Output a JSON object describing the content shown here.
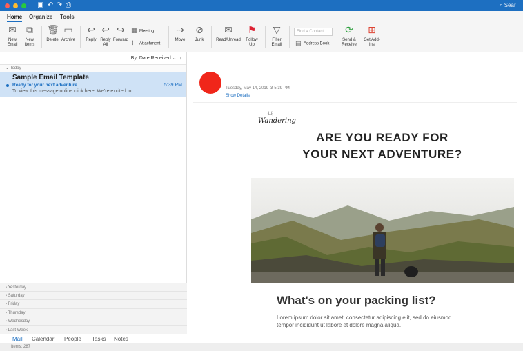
{
  "titlebar": {
    "search_label": "Sear",
    "colors": {
      "bar": "#1d6fc1",
      "close": "#fe5f57",
      "minimize": "#febc2e",
      "maximize": "#28c840"
    }
  },
  "tabs": [
    {
      "label": "Home",
      "active": true
    },
    {
      "label": "Organize"
    },
    {
      "label": "Tools"
    }
  ],
  "ribbon": {
    "new_email": "New Email",
    "new_items": "New Items",
    "delete": "Delete",
    "archive": "Archive",
    "reply": "Reply",
    "reply_all": "Reply All",
    "forward": "Forward",
    "meeting": "Meeting",
    "attachment": "Attachment",
    "move": "Move",
    "junk": "Junk",
    "read_unread": "Read/Unread",
    "follow_up": "Follow Up",
    "filter_email": "Filter Email",
    "find_contact_placeholder": "Find a Contact",
    "address_book": "Address Book",
    "send_receive": "Send & Receive",
    "get_addins": "Get Add-ins"
  },
  "message_list": {
    "sort_label": "By: Date Received",
    "today_group": "Today",
    "item": {
      "from": "Sample Email Template",
      "subject": "Ready for your next adventure",
      "preview": "To view this message online click here. We're excited to…",
      "time": "5:39 PM"
    },
    "groups": [
      "Yesterday",
      "Saturday",
      "Friday",
      "Thursday",
      "Wednesday",
      "Last Week"
    ]
  },
  "reading_pane": {
    "date": "Tuesday, May 14, 2019 at 5:39 PM",
    "show_details": "Show Details",
    "avatar_color": "#f0261a",
    "email": {
      "logo": "Wandering",
      "hero_title_line1": "ARE YOU READY FOR",
      "hero_title_line2": "YOUR NEXT ADVENTURE?",
      "section_title": "What's on your packing list?",
      "body_line1": "Lorem ipsum dolor sit amet, consectetur adipiscing elit, sed do eiusmod",
      "body_line2": "tempor incididunt ut labore et dolore magna aliqua."
    }
  },
  "navbar": [
    {
      "label": "Mail",
      "active": true
    },
    {
      "label": "Calendar"
    },
    {
      "label": "People"
    },
    {
      "label": "Tasks"
    },
    {
      "label": "Notes"
    }
  ],
  "status": {
    "items": "Items: 287"
  }
}
